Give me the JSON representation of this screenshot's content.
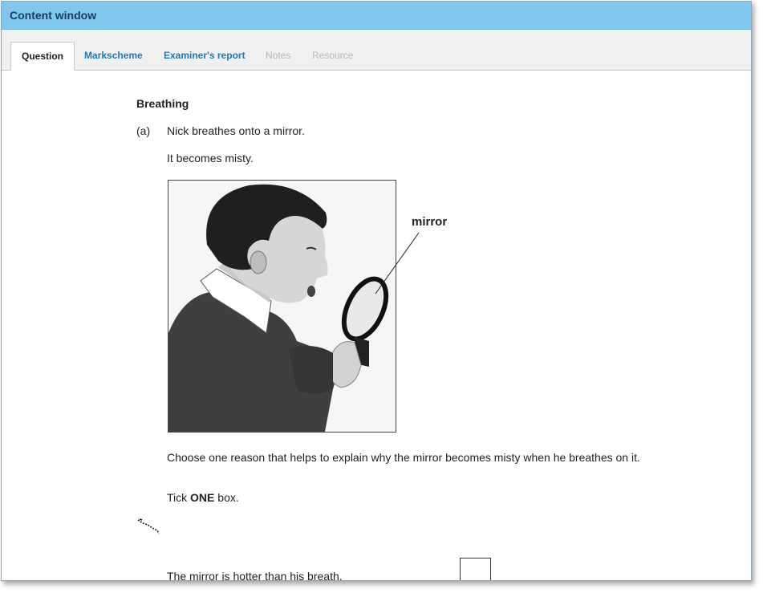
{
  "window": {
    "title": "Content window"
  },
  "tabs": [
    {
      "label": "Question",
      "state": "active"
    },
    {
      "label": "Markscheme",
      "state": "enabled"
    },
    {
      "label": "Examiner's report",
      "state": "enabled"
    },
    {
      "label": "Notes",
      "state": "disabled"
    },
    {
      "label": "Resource",
      "state": "disabled"
    }
  ],
  "question": {
    "title": "Breathing",
    "part": "(a)",
    "line1": "Nick breathes onto a mirror.",
    "line2": "It becomes misty.",
    "figure_label": "mirror",
    "prompt": "Choose one reason that helps to explain why the mirror becomes misty when he breathes on it.",
    "instruction_prefix": "Tick ",
    "instruction_bold": "ONE",
    "instruction_suffix": " box.",
    "options": [
      {
        "text": "The mirror is hotter than his breath."
      }
    ]
  },
  "colors": {
    "titlebar": "#80c8ee",
    "tab_link": "#1a7ab8",
    "tab_disabled": "#b8b8b8"
  }
}
